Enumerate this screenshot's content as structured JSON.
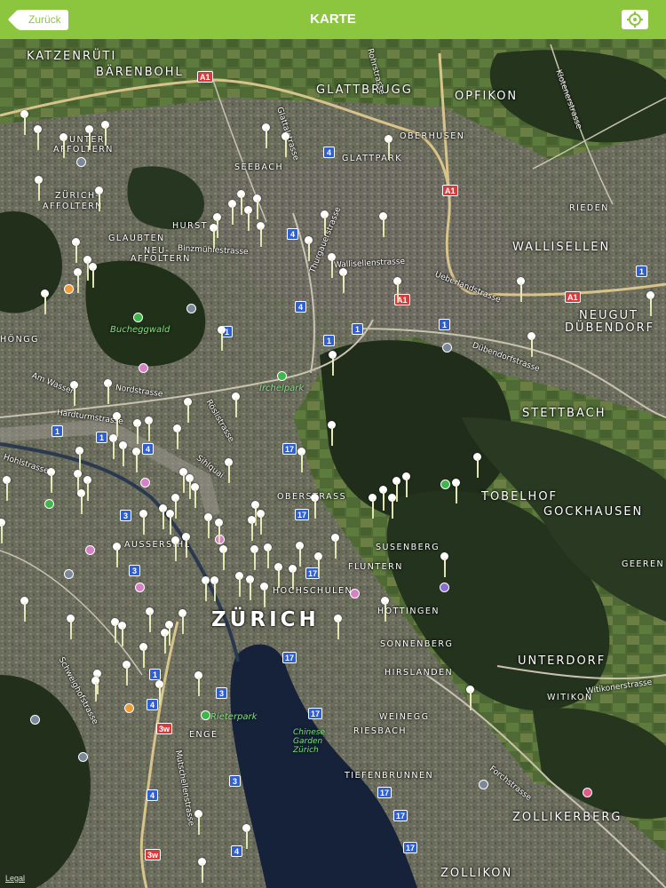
{
  "header": {
    "title": "KARTE",
    "back_label": "Zurück",
    "locate_icon": "locate-icon",
    "color": "#8cc63f"
  },
  "map": {
    "places": [
      {
        "name": "KATZENRÜTI",
        "cls": "big"
      },
      {
        "name": "BÄRENBOHL",
        "cls": "big"
      },
      {
        "name": "GLATTBRUGG",
        "cls": "big"
      },
      {
        "name": "OPFIKON",
        "cls": "big"
      },
      {
        "name": "OBERHUSEN",
        "cls": "small"
      },
      {
        "name": "GLATTPARK",
        "cls": "small"
      },
      {
        "name": "SEEBACH",
        "cls": "small"
      },
      {
        "name": "UNTER-",
        "cls": "small"
      },
      {
        "name": "AFFOLTERN",
        "cls": "small"
      },
      {
        "name": "ZÜRICH-",
        "cls": "small"
      },
      {
        "name": "AFFOLTERN",
        "cls": "small"
      },
      {
        "name": "HURST",
        "cls": "small"
      },
      {
        "name": "GLAUBTEN",
        "cls": "small"
      },
      {
        "name": "NEU-",
        "cls": "small"
      },
      {
        "name": "AFFOLTERN",
        "cls": "small"
      },
      {
        "name": "RIEDEN",
        "cls": "small"
      },
      {
        "name": "WALLISELLEN",
        "cls": "big"
      },
      {
        "name": "NEUGUT",
        "cls": "big"
      },
      {
        "name": "DÜBENDORF",
        "cls": "big"
      },
      {
        "name": "STETTBACH",
        "cls": "big"
      },
      {
        "name": "TOBELHOF",
        "cls": "big"
      },
      {
        "name": "GOCKHAUSEN",
        "cls": "big"
      },
      {
        "name": "OBERSTRASS",
        "cls": "small"
      },
      {
        "name": "SUSENBERG",
        "cls": "small"
      },
      {
        "name": "FLUNTERN",
        "cls": "small"
      },
      {
        "name": "HOCHSCHULEN",
        "cls": "small"
      },
      {
        "name": "AUSSERSIHL",
        "cls": "small"
      },
      {
        "name": "ZÜRICH",
        "cls": "city"
      },
      {
        "name": "HOTTINGEN",
        "cls": "small"
      },
      {
        "name": "SONNENBERG",
        "cls": "small"
      },
      {
        "name": "HIRSLANDEN",
        "cls": "small"
      },
      {
        "name": "UNTERDORF",
        "cls": "big"
      },
      {
        "name": "WITIKON",
        "cls": "small"
      },
      {
        "name": "GEEREN",
        "cls": "small"
      },
      {
        "name": "WEINEGG",
        "cls": "small"
      },
      {
        "name": "RIESBACH",
        "cls": "small"
      },
      {
        "name": "ENGE",
        "cls": "small"
      },
      {
        "name": "TIEFENBRUNNEN",
        "cls": "small"
      },
      {
        "name": "ZOLLIKERBERG",
        "cls": "big"
      },
      {
        "name": "ZOLLIKON",
        "cls": "big"
      },
      {
        "name": "HÖNGG",
        "cls": "small"
      }
    ],
    "streets": [
      "Rohrstrasse",
      "Klotenerstrasse",
      "Glattalstrasse",
      "Binzmühlestrasse",
      "Thurgauerstrasse",
      "Wallisellenstrasse",
      "Ueberlandstrasse",
      "Dübendorfstrasse",
      "Nordstrasse",
      "Am Wasser",
      "Hardturmstrasse",
      "Hohlstrasse",
      "Röslistrasse",
      "Sihlquai",
      "Schweighofstrasse",
      "Mutschellenstrasse",
      "Forchstrasse",
      "Witikonerstrasse",
      "Affoltern­strasse"
    ],
    "parks": [
      "Bucheggwald",
      "Irchelpark",
      "Rieterpark",
      "Chinese Garden Zürich"
    ],
    "road_shields": [
      "A1",
      "A1",
      "A1",
      "A1",
      "3w",
      "3w",
      "4",
      "4",
      "4",
      "1",
      "1",
      "1",
      "1",
      "1",
      "17",
      "17",
      "17",
      "17",
      "17",
      "17",
      "17",
      "17",
      "3",
      "3",
      "3",
      "3",
      "4",
      "4",
      "4",
      "4",
      "1",
      "1",
      "1"
    ],
    "legal": "Legal"
  }
}
